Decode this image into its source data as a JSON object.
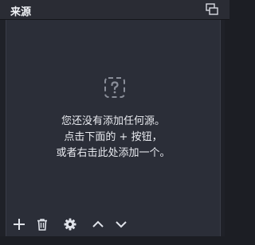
{
  "dock": {
    "title": "来源"
  },
  "empty_state": {
    "icon": "question-mark-icon",
    "line1": "您还没有添加任何源。",
    "line2": "点击下面的 + 按钮，",
    "line3": "或者右击此处添加一个。"
  },
  "toolbar": {
    "buttons": [
      {
        "name": "add-source-button",
        "icon": "plus-icon"
      },
      {
        "name": "remove-source-button",
        "icon": "trash-icon"
      },
      {
        "name": "source-properties-button",
        "icon": "gear-icon"
      },
      {
        "name": "move-source-up-button",
        "icon": "chevron-up-icon"
      },
      {
        "name": "move-source-down-button",
        "icon": "chevron-down-icon"
      }
    ]
  },
  "colors": {
    "titlebar_bg": "#2a2c34",
    "panel_bg": "#2b2e38",
    "text": "#e8eaef",
    "icon": "#d8dbe2"
  }
}
